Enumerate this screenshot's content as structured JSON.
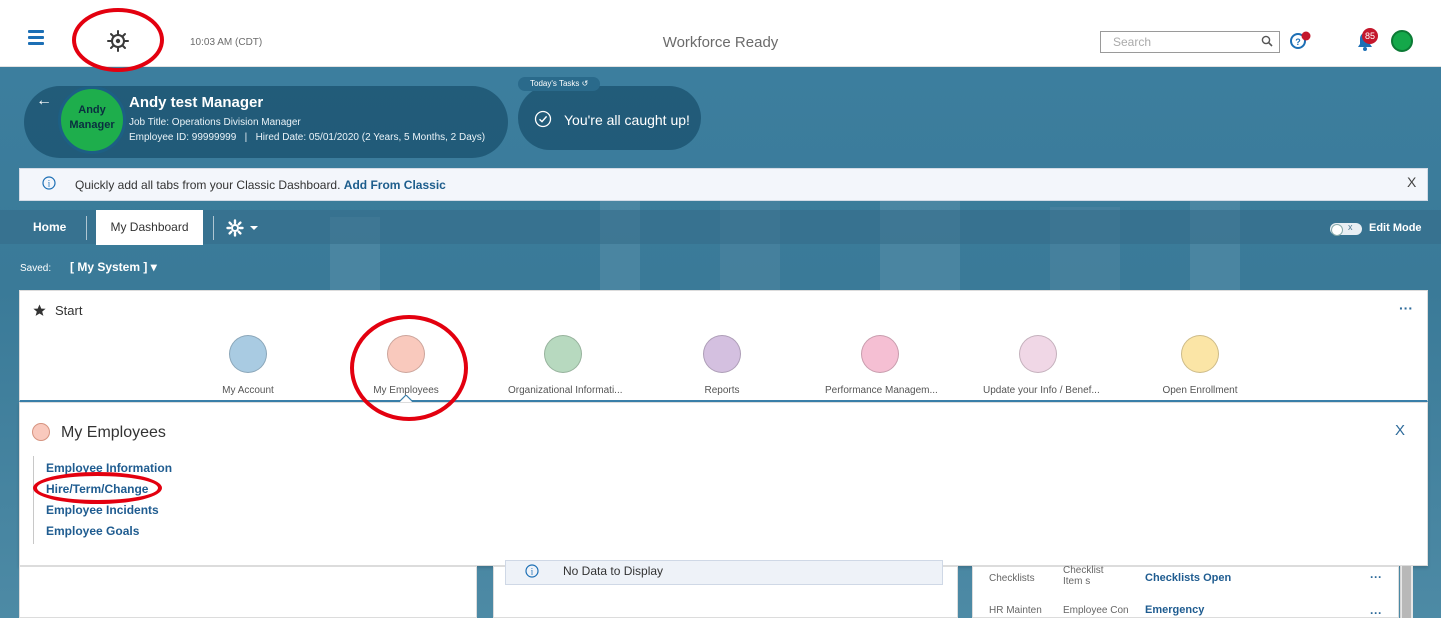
{
  "header": {
    "clock": "10:03 AM (CDT)",
    "app_title": "Workforce Ready",
    "search_placeholder": "Search",
    "notification_count": "85"
  },
  "profile": {
    "avatar_line1": "Andy",
    "avatar_line2": "Manager",
    "name": "Andy test Manager",
    "job_title": "Job Title: Operations Division Manager",
    "ids": "Employee ID: 99999999   |   Hired Date: 05/01/2020 (2 Years, 5 Months, 2 Days)"
  },
  "tasks": {
    "tag": "Today's Tasks ↺",
    "status": "You're all caught up!"
  },
  "banner": {
    "text": "Quickly add all tabs from your Classic Dashboard.",
    "link": "Add From Classic",
    "close": "X"
  },
  "tabs": {
    "home": "Home",
    "dashboard": "My Dashboard",
    "edit_mode": "Edit Mode"
  },
  "saved": {
    "label": "Saved:",
    "value": "[ My System ] ▾"
  },
  "start": {
    "title": "Start",
    "more": "···",
    "tiles": [
      {
        "label": "My Account",
        "color": "#a9cbe2"
      },
      {
        "label": "My Employees",
        "color": "#f9c9bd"
      },
      {
        "label": "Organizational Informati...",
        "color": "#b7d9bf"
      },
      {
        "label": "Reports",
        "color": "#d4c0e0"
      },
      {
        "label": "Performance Managem...",
        "color": "#f5bfd3"
      },
      {
        "label": "Update your Info / Benef...",
        "color": "#f0d7e6"
      },
      {
        "label": "Open Enrollment",
        "color": "#fbe5a6"
      }
    ]
  },
  "employees": {
    "title": "My Employees",
    "close": "X",
    "links": [
      "Employee Information",
      "Hire/Term/Change",
      "Employee Incidents",
      "Employee Goals"
    ]
  },
  "widgets": {
    "no_data": "No Data to Display",
    "rows": [
      {
        "col1": "Checklists",
        "col2": "Checklist Item s",
        "col3": "Checklists Open",
        "more": "···"
      },
      {
        "col1": "HR Mainten",
        "col2": "Employee Con",
        "col3": "Emergency",
        "more": "···"
      }
    ]
  },
  "colors": {
    "accent": "#1c6fb5",
    "link": "#1f5c90",
    "annotation_red": "#e3000f",
    "hero": "#3c7e9e"
  }
}
